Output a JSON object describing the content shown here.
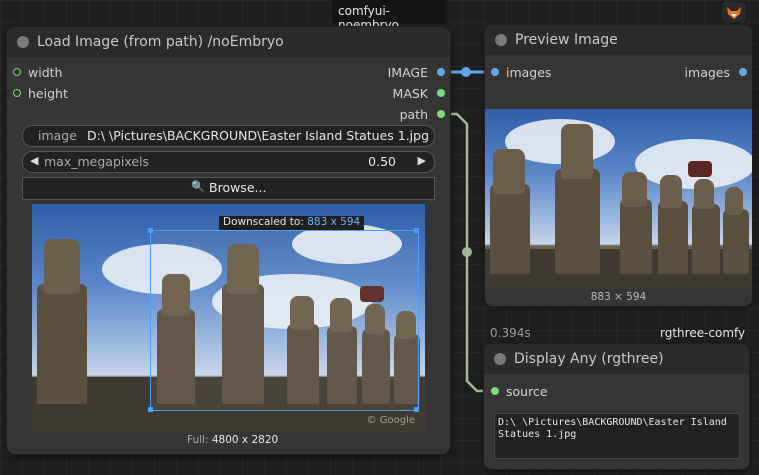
{
  "group_label": "comfyui-noembryo",
  "load_node": {
    "title": "Load Image (from path) /noEmbryo",
    "inputs": [
      "width",
      "height"
    ],
    "outputs": [
      "IMAGE",
      "MASK",
      "path"
    ],
    "image_label": "image",
    "image_value": "D:\\ \\Pictures\\BACKGROUND\\Easter Island Statues 1.jpg",
    "megapixels_label": "max_megapixels",
    "megapixels_value": "0.50",
    "left_arrow": "◀",
    "right_arrow": "▶",
    "browse_label": "Browse...",
    "browse_icon": "🔍",
    "downscaled_prefix": "Downscaled to:",
    "downscaled_value": "883 x 594",
    "full_prefix": "Full:",
    "full_value": "4800 x 2820",
    "watermark": "© Google"
  },
  "preview_node": {
    "title": "Preview Image",
    "input": "images",
    "output": "images",
    "caption": "883 × 594"
  },
  "time_badge": "0.394s",
  "rgthree_badge": "rgthree-comfy",
  "display_node": {
    "title": "Display Any (rgthree)",
    "input": "source",
    "text": "D:\\ \\Pictures\\BACKGROUND\\Easter Island Statues 1.jpg"
  },
  "colors": {
    "image_link": "#5fa8e8",
    "path_link": "#a3b89a",
    "green_slot": "#7fd97f"
  },
  "icons": {
    "corner": "fox-icon"
  }
}
